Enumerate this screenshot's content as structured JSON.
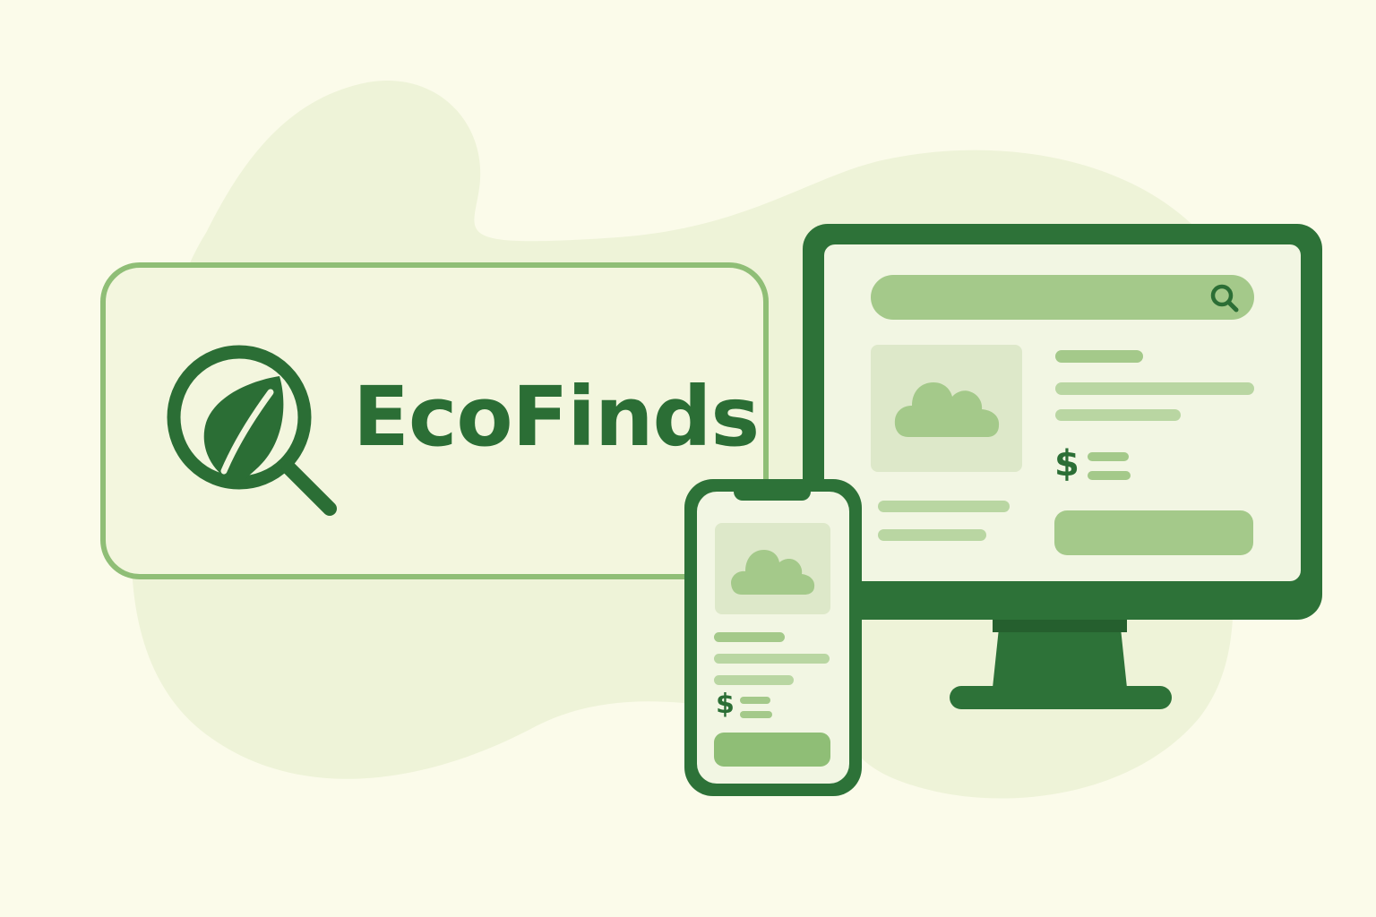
{
  "brand": {
    "name": "EcoFinds",
    "logo_icon": "leaf-magnifier-icon"
  },
  "monitor": {
    "search_icon": "search-icon",
    "image_icon": "cloud-image-icon",
    "price_symbol": "$"
  },
  "phone": {
    "image_icon": "cloud-image-icon",
    "price_symbol": "$"
  },
  "colors": {
    "background": "#fbfbea",
    "blob": "#eef3d8",
    "brand_green": "#2d7238",
    "accent_green": "#a4c98a",
    "light_green": "#b9d6a2",
    "card_border": "#8fbe76"
  }
}
